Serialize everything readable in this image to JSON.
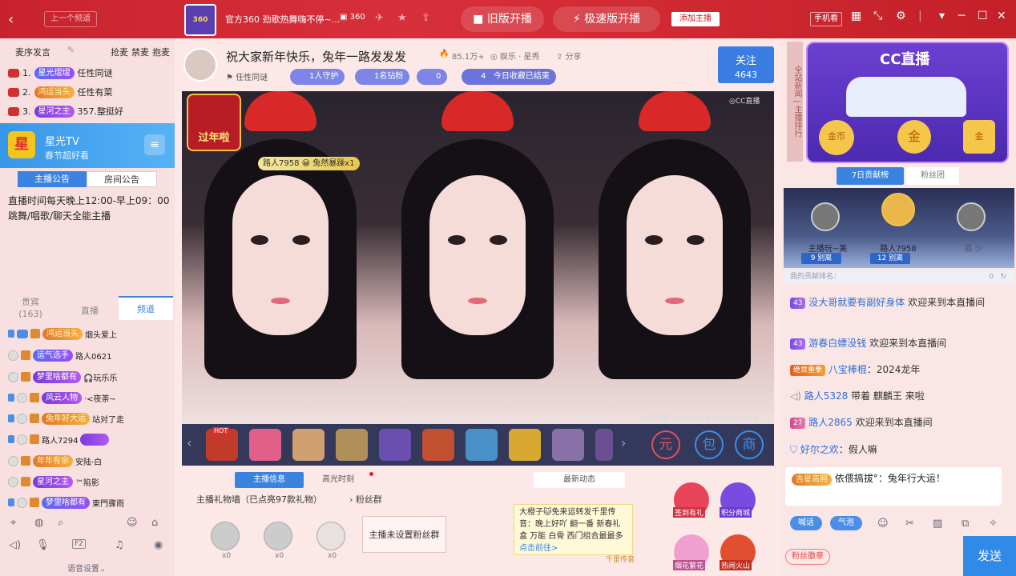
{
  "titlebar": {
    "back": "‹",
    "prev_room": "上一个频道",
    "logo_text": "360",
    "room_title": "官方360 劲歌热舞嗨不停~...",
    "room_id": "360",
    "old_stream": "旧版开播",
    "fast_stream": "极速版开播",
    "add_host": "添加主播",
    "phone_view": "手机看",
    "min": "─",
    "max": "☐",
    "close": "✕"
  },
  "left": {
    "tabs": [
      "麦序发言",
      "抢麦",
      "禁麦",
      "抱麦"
    ],
    "ranks": [
      {
        "no": "1.",
        "badge": "星光熠熠",
        "name": "任性同谜"
      },
      {
        "no": "2.",
        "badge": "鸿运当头",
        "name": "任性有菜"
      },
      {
        "no": "3.",
        "badge": "星河之主",
        "name": "357.整挺好"
      }
    ],
    "promo": {
      "logo": "星",
      "name": "星光TV",
      "sub": "春节超好看",
      "menu": "≡"
    },
    "notice_tabs": [
      "主播公告",
      "房间公告"
    ],
    "notice": "直播时间每天晚上12:00-早上09：00 跳舞/唱歌/聊天全能主播",
    "viewer_tabs": [
      "贵宾\n(163)",
      "直播",
      "频道"
    ],
    "viewers": [
      {
        "badge": "鸿运当头",
        "name": "烟头爱上"
      },
      {
        "badge": "运气选手",
        "name": "路人0621"
      },
      {
        "badge": "梦里啥都有",
        "name": "🎧玩乐乐"
      },
      {
        "badge": "风云人物",
        "name": "·<夜荼~"
      },
      {
        "badge": "兔年好大运",
        "name": "站对了走"
      },
      {
        "badge": "",
        "name": "路人7294"
      },
      {
        "badge": "年年有余",
        "name": "安陆·白"
      },
      {
        "badge": "星河之主",
        "name": "™陷影"
      },
      {
        "badge": "梦里啥都有",
        "name": "東門骤雨"
      }
    ],
    "voice_setting": "语音设置"
  },
  "room": {
    "title": "祝大家新年快乐，兔年一路发发发",
    "hot": "85.1万+",
    "category": "娱乐 · 星秀",
    "share": "分享",
    "host": "任性同谜",
    "guard": "1人守护",
    "diamond": "1名钻粉",
    "fans": "0",
    "fav_level": "4",
    "fav_text": "今日收藏已结束",
    "follow": "关注",
    "follow_count": "4643"
  },
  "video": {
    "watermark": "◎CC直播",
    "stamp": "CC直播 BJ64q4N4 2023.01.24",
    "new_year": "过年啦",
    "enter_msg": "路人7958 😀 兔然暴躁x1"
  },
  "giftbar": {
    "hot": "HOT",
    "btn_yuan": "元",
    "btn_bag": "包",
    "btn_shop": "商"
  },
  "info": {
    "tabs": [
      "主播信息",
      "高光时刻",
      "最新动态"
    ],
    "wall": "主播礼物墙（已点亮97款礼物）",
    "fan_group": "粉丝群",
    "gifts_count": [
      "x0",
      "x0",
      "x0"
    ],
    "no_fan": "主播未设置粉丝群",
    "news": "大橙子🐱免来运转发千里传音：晚上好吖 翻一番 新春礼盒 万能 白骨 西门组合最最多",
    "news_link": "点击前往>",
    "news_tag": "千里传音",
    "acts": [
      "签到有礼",
      "积分商城",
      "烟花繁花",
      "热闹火山"
    ]
  },
  "right": {
    "sidebar": "全站新闻 | 主播排行",
    "banner": "CC直播",
    "coins": [
      "金币",
      "金",
      "金"
    ],
    "tabs": [
      "7日贡献榜",
      "粉丝团"
    ],
    "podium": [
      {
        "name": "主播玩~美",
        "num": "9",
        "tag": "别离"
      },
      {
        "name": "路人7958",
        "num": "12",
        "tag": "别离"
      },
      {
        "name": "孤 少",
        "num": "",
        "tag": ""
      }
    ],
    "my_rank": "我的贡献排名：",
    "my_rank_val": "0",
    "messages": [
      {
        "tag": "43",
        "user": "没大哥就要有副好身体",
        "text": " 欢迎来到本直播间"
      },
      {
        "tag": "43",
        "user": "游春白嫖没钱",
        "text": " 欢迎来到本直播间"
      },
      {
        "tag": "绝世重拳",
        "user": "八宝棒棍",
        "text": "：2024龙年"
      },
      {
        "tag": "",
        "user": "路人5328",
        "text": " 带着 麒麟王 来啦"
      },
      {
        "tag": "27",
        "user": "路人2865",
        "text": " 欢迎来到本直播间"
      },
      {
        "tag": "",
        "user": "好尔之欢",
        "text": "：假人嘛"
      }
    ],
    "self_msg": "依偎搞拔°：兔年行大运！",
    "self_tag": "吉星高照",
    "btn_speech": "喊话",
    "btn_bubble": "气泡",
    "fan_badge": "粉丝徽章",
    "send": "发送"
  }
}
